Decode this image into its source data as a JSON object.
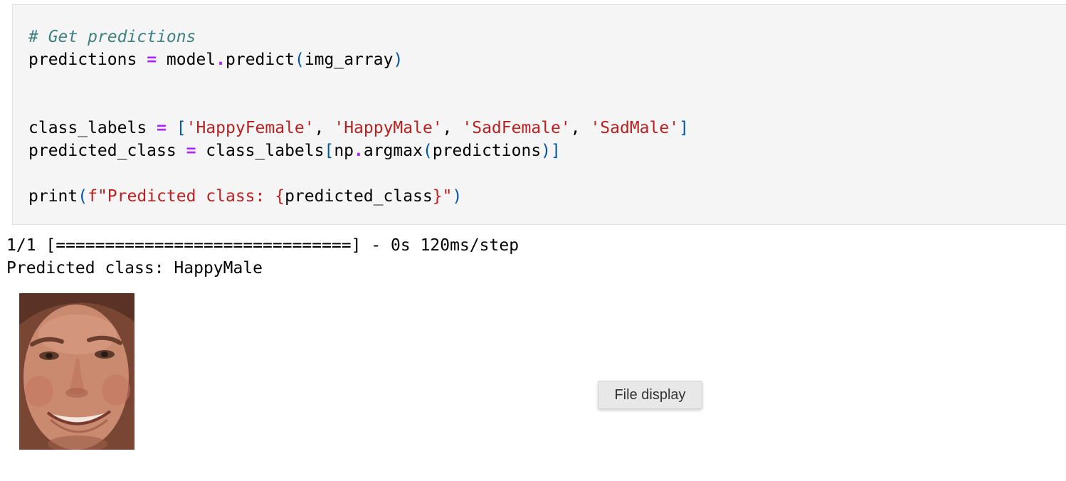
{
  "code_cell": {
    "lines": {
      "comment": "# Get predictions",
      "predictions_var": "predictions",
      "eq": "=",
      "model_call": "model",
      "dot": ".",
      "predict_fn": "predict",
      "lparen": "(",
      "img_array": "img_array",
      "rparen": ")",
      "class_labels_var": "class_labels",
      "lbracket": "[",
      "label_0": "'HappyFemale'",
      "label_1": "'HappyMale'",
      "label_2": "'SadFemale'",
      "label_3": "'SadMale'",
      "comma": ",",
      "rbracket": "]",
      "predicted_class_var": "predicted_class",
      "class_labels_ref": "class_labels",
      "np": "np",
      "argmax": "argmax",
      "predictions_arg": "predictions",
      "print_fn": "print",
      "fstring_open": "f\"Predicted class: ",
      "brace_open": "{",
      "predicted_class_ref": "predicted_class",
      "brace_close": "}",
      "fstring_close": "\""
    }
  },
  "output": {
    "progress_line": "1/1 [==============================] - 0s 120ms/step",
    "result_line": "Predicted class: HappyMale"
  },
  "tooltip": {
    "label": "File display"
  },
  "colors": {
    "comment": "#408080",
    "operator": "#aa22ff",
    "bracket": "#0055aa",
    "string": "#ba2121",
    "cell_background": "#f5f5f5"
  }
}
